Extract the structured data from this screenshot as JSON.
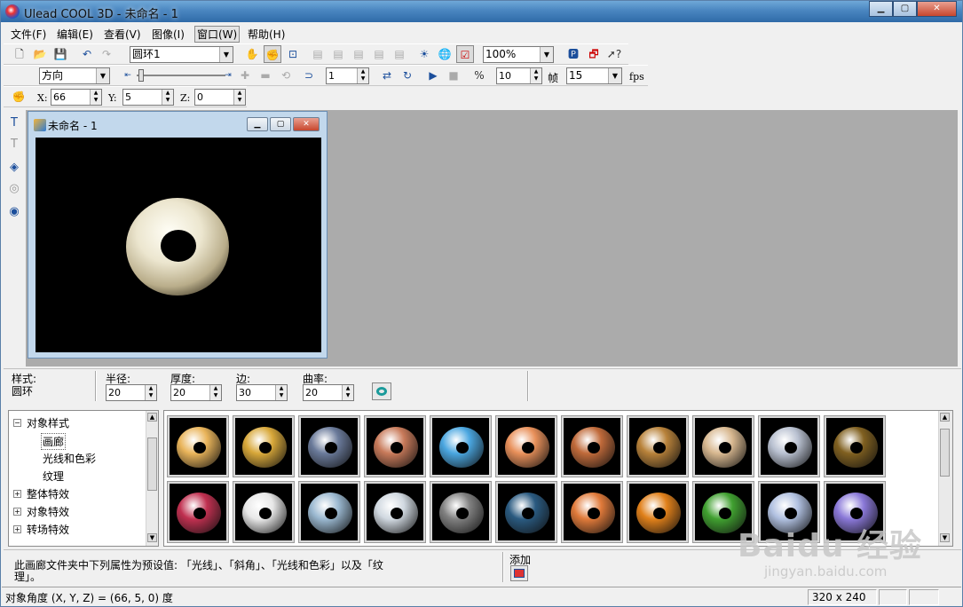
{
  "window": {
    "title": "Ulead COOL 3D - 未命名 - 1"
  },
  "menu": [
    "文件(F)",
    "编辑(E)",
    "查看(V)",
    "图像(I)",
    "窗口(W)",
    "帮助(H)"
  ],
  "toolbar1": {
    "object_select": "圆环1",
    "zoom": "100%"
  },
  "toolbar2": {
    "direction": "方向",
    "frame": "1",
    "speed": "10",
    "frame_label": "帧",
    "fps_value": "15",
    "fps_label": "fps"
  },
  "toolbar3": {
    "x_label": "X:",
    "x": "66",
    "y_label": "Y:",
    "y": "5",
    "z_label": "Z:",
    "z": "0"
  },
  "document": {
    "title": "未命名 - 1"
  },
  "props": {
    "style_label": "样式:",
    "style_value": "圆环",
    "radius_label": "半径:",
    "radius": "20",
    "thickness_label": "厚度:",
    "thickness": "20",
    "edges_label": "边:",
    "edges": "30",
    "curvature_label": "曲率:",
    "curvature": "20"
  },
  "tree": {
    "root": "对象样式",
    "children": [
      "画廊",
      "光线和色彩",
      "纹理"
    ],
    "others": [
      "整体特效",
      "对象特效",
      "转场特效"
    ]
  },
  "info": {
    "text_line1": "此画廊文件夹中下列属性为预设值: 「光线」、「斜角」、「光线和色彩」以及「纹",
    "text_line2": "理」。",
    "add_label": "添加"
  },
  "status": {
    "angle": "对象角度 (X, Y, Z) = (66, 5, 0) 度",
    "size": "320 x 240"
  },
  "watermark": {
    "brand": "Baidu 经验",
    "url": "jingyan.baidu.com"
  },
  "thumbnails": [
    "#e9b45a",
    "#d8a83a",
    "#6a7a9a",
    "#c87a5a",
    "#4aa6e0",
    "#e8905a",
    "#c06a3a",
    "#b8823a",
    "#d8b890",
    "#b8c0d0",
    "#806020",
    "#c03050",
    "#e8e8e8",
    "#9ab8d0",
    "#d0d8e0",
    "#808080",
    "#2a5a80",
    "#e07a3a",
    "#e0801a",
    "#40a030",
    "#b0c0e0",
    "#8a78d8"
  ]
}
